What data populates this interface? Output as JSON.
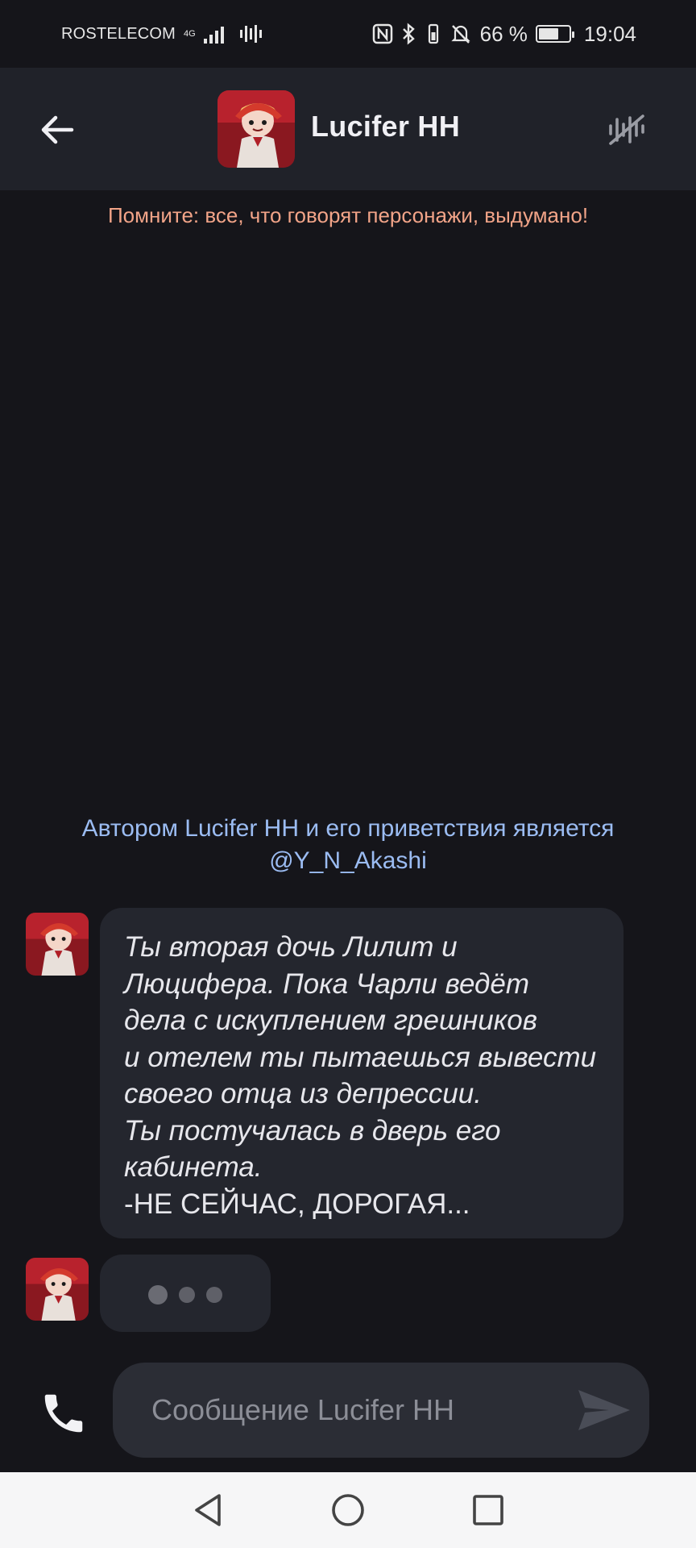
{
  "status_bar": {
    "carrier": "ROSTELECOM",
    "network": "4G",
    "battery": "66 %",
    "battery_level": 0.66,
    "time": "19:04"
  },
  "header": {
    "character_name": "Lucifer HH",
    "back_icon": "arrow-left-icon",
    "mute_icon": "muted-audio-icon"
  },
  "chat": {
    "warning": "Помните: все, что говорят персонажи, выдумано!",
    "author_line1": "Автором Lucifer HH и его приветствия является",
    "author_line2": "@Y_N_Akashi",
    "messages": [
      {
        "lines": [
          "Ты вторая дочь Лилит и",
          "Люцифера. Пока Чарли ведёт",
          "дела с искуплением грешников",
          "и отелем ты пытаешься вывести",
          "своего отца из депрессии.",
          "Ты постучалась в дверь его",
          "кабинета.",
          "-НЕ СЕЙЧАС, ДОРОГАЯ..."
        ]
      }
    ]
  },
  "composer": {
    "placeholder": "Сообщение Lucifer HH",
    "call_icon": "phone-icon",
    "send_icon": "send-icon"
  },
  "nav": {
    "back_icon": "triangle-back-icon",
    "home_icon": "circle-home-icon",
    "recents_icon": "square-recents-icon"
  },
  "colors": {
    "background": "#15151a",
    "header": "#202229",
    "bubble": "#24262e",
    "warning": "#f2a488",
    "author": "#9bbcf2"
  }
}
